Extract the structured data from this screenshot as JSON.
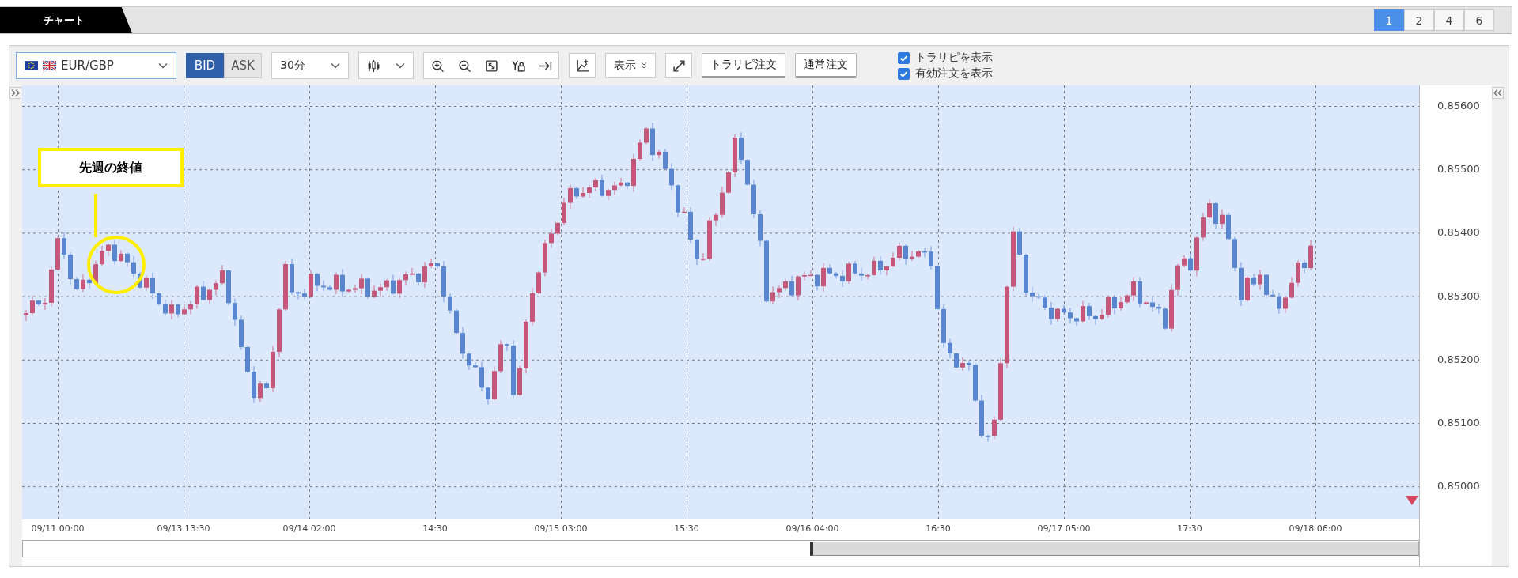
{
  "tabs": [
    {
      "label": "チャート",
      "selected": true
    }
  ],
  "layout_buttons": [
    {
      "label": "1",
      "selected": true
    },
    {
      "label": "2",
      "selected": false
    },
    {
      "label": "4",
      "selected": false
    },
    {
      "label": "6",
      "selected": false
    }
  ],
  "toolbar": {
    "symbol": "EUR/GBP",
    "price_types": [
      {
        "label": "BID",
        "selected": true
      },
      {
        "label": "ASK",
        "selected": false
      }
    ],
    "interval": "30分",
    "display_button": "表示",
    "order_buttons": [
      "トラリピ注文",
      "通常注文"
    ],
    "options": [
      {
        "label": "トラリピを表示",
        "checked": true
      },
      {
        "label": "有効注文を表示",
        "checked": true
      }
    ]
  },
  "chart": {
    "annotation": "先週の終値",
    "price_ticks": [
      "0.85600",
      "0.85500",
      "0.85400",
      "0.85300",
      "0.85200",
      "0.85100",
      "0.85000"
    ],
    "time_ticks": [
      "09/11 00:00",
      "09/13 13:30",
      "09/14 02:00",
      "14:30",
      "09/15 03:00",
      "15:30",
      "09/16 04:00",
      "16:30",
      "09/17 05:00",
      "17:30",
      "09/18 06:00"
    ]
  }
}
